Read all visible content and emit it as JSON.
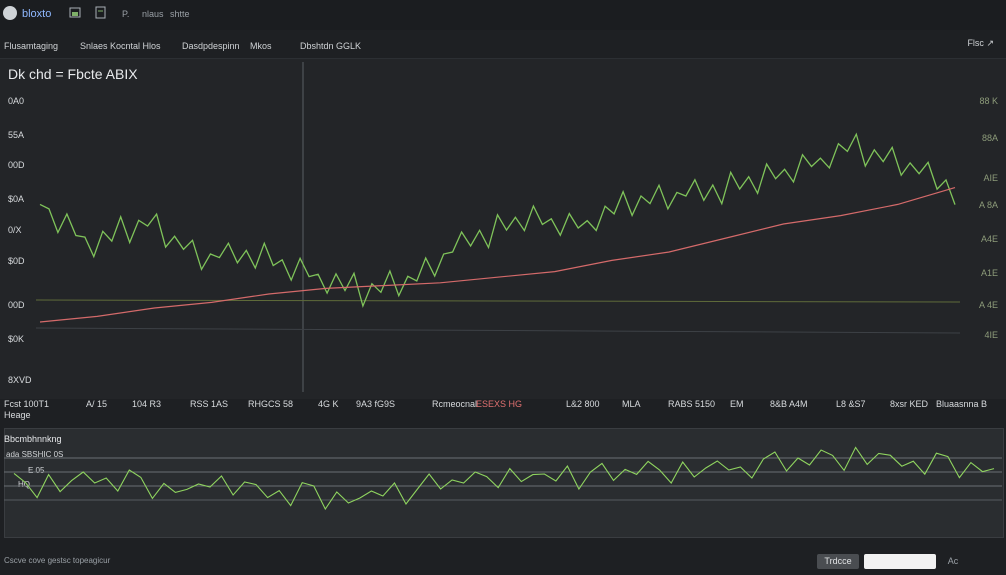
{
  "window": {
    "app_name": "bloxto",
    "toolbar_texts": [
      "P.",
      "nlaus",
      "shtte"
    ]
  },
  "menu": {
    "items": [
      "Flusamtaging",
      "Snlaes Kocntal Hlos",
      "Dasdpdespinn",
      "Mkos",
      "Dbshtdn  GGLK"
    ],
    "corner": "Flsc"
  },
  "chart": {
    "title": "Dk  chd  = Fbcte ABIX",
    "y_left_labels": [
      "0A0",
      "55A",
      "00D",
      "$0A",
      "0/X",
      "$0D",
      "00D",
      "$0K",
      "8XVD"
    ],
    "y_right_labels": [
      "88 K",
      "88A",
      "AIE",
      "A 8A",
      "A4E",
      "A1E",
      "A 4E",
      "4IE"
    ],
    "x_labels": [
      "Fcst  100T1",
      "A/ 15",
      "104  R3",
      "RSS  1AS",
      "RHGCS 58",
      "4G  K",
      "9A3  fG9S",
      "Rcmeocnal",
      "ESEXS  HG",
      "L&2  800",
      "MLA",
      "RABS  5150",
      "EM",
      "8&B  A4M",
      "L8 &S7",
      "8xsr  KED",
      "Bluaasnna  B"
    ],
    "x_sub_label": "Heage"
  },
  "chart_data": {
    "type": "line",
    "series": [
      {
        "values": [
          62,
          48,
          55,
          42,
          45,
          38,
          30,
          35,
          50,
          58,
          55,
          62,
          65,
          70,
          75,
          82,
          76,
          68
        ]
      },
      {
        "values": [
          20,
          22,
          25,
          27,
          30,
          32,
          33,
          34,
          36,
          38,
          42,
          45,
          50,
          55,
          58,
          62,
          68
        ]
      }
    ]
  },
  "sub_panel": {
    "title": "Bbcmbhnnkng",
    "legend_lines": [
      "ada  SBSHIC  0S",
      "E 05",
      "HQ"
    ]
  },
  "status": {
    "left": "Cscve cove gestsc topeagicur",
    "button_primary": "Trdcce",
    "button_secondary": "",
    "right_text": "Ac"
  }
}
